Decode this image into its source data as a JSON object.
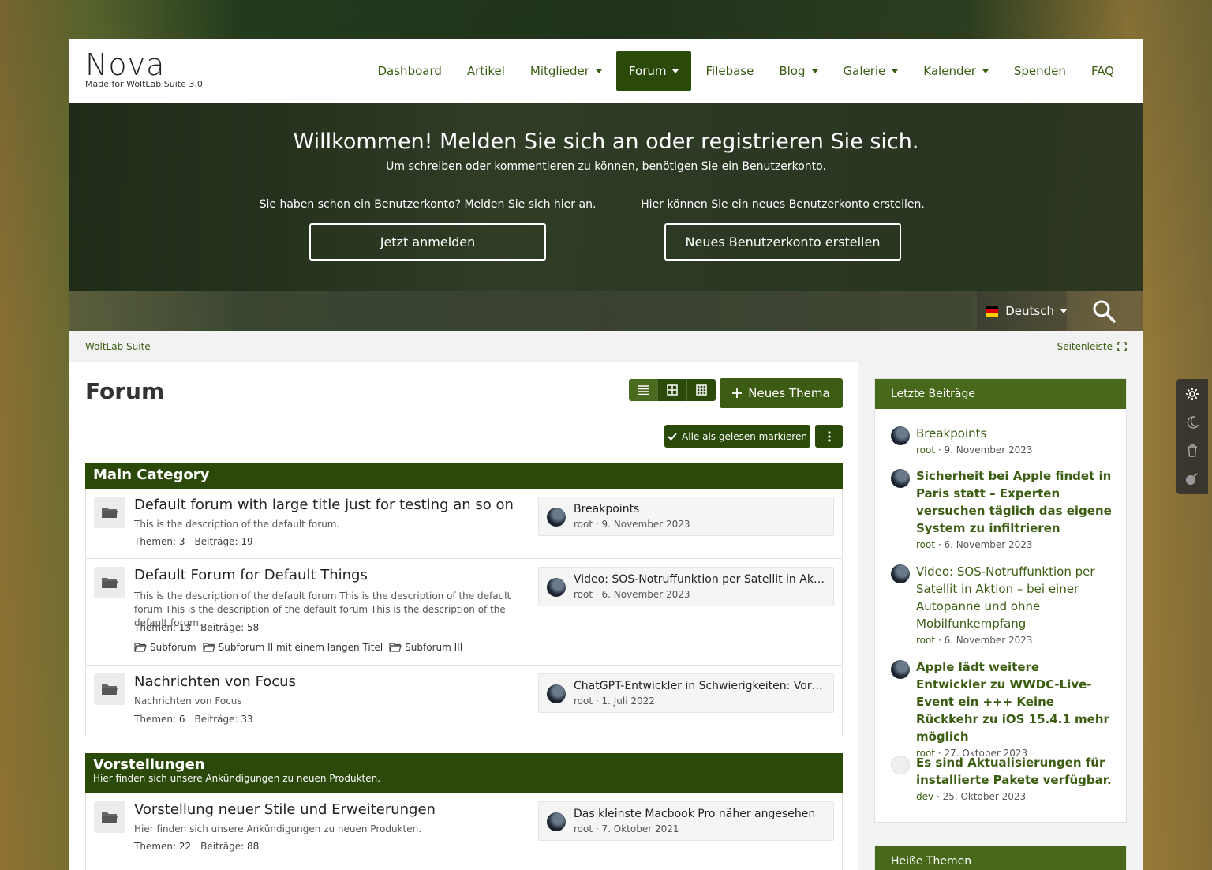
{
  "logo": {
    "name": "Nova",
    "sub": "Made for WoltLab Suite 3.0"
  },
  "nav": [
    {
      "label": "Dashboard",
      "caret": false,
      "active": false
    },
    {
      "label": "Artikel",
      "caret": false,
      "active": false
    },
    {
      "label": "Mitglieder",
      "caret": true,
      "active": false
    },
    {
      "label": "Forum",
      "caret": true,
      "active": true
    },
    {
      "label": "Filebase",
      "caret": false,
      "active": false
    },
    {
      "label": "Blog",
      "caret": true,
      "active": false
    },
    {
      "label": "Galerie",
      "caret": true,
      "active": false
    },
    {
      "label": "Kalender",
      "caret": true,
      "active": false
    },
    {
      "label": "Spenden",
      "caret": false,
      "active": false
    },
    {
      "label": "FAQ",
      "caret": false,
      "active": false
    }
  ],
  "hero": {
    "title": "Willkommen! Melden Sie sich an oder registrieren Sie sich.",
    "lead": "Um schreiben oder kommentieren zu können, benötigen Sie ein Benutzerkonto.",
    "login_text": "Sie haben schon ein Benutzerkonto? Melden Sie sich hier an.",
    "login_button": "Jetzt anmelden",
    "register_text": "Hier können Sie ein neues Benutzerkonto erstellen.",
    "register_button": "Neues Benutzerkonto erstellen"
  },
  "search": {
    "language": "Deutsch"
  },
  "breadcrumb": {
    "home": "WoltLab Suite",
    "sidebar_toggle": "Seitenleiste"
  },
  "page": {
    "title": "Forum",
    "new_topic": "Neues Thema",
    "mark_read": "Alle als gelesen markieren"
  },
  "categories": [
    {
      "title": "Main Category",
      "description": ""
    },
    {
      "title": "Vorstellungen",
      "description": "Hier finden sich unsere Ankündigungen zu neuen Produkten."
    }
  ],
  "boards": [
    {
      "name": "Default forum with large title just for testing an so on",
      "description": "This is the description of the default forum.",
      "topics_label": "Themen",
      "topics": "3",
      "posts_label": "Beiträge",
      "posts": "19",
      "last_title": "Breakpoints",
      "last_meta": "root · 9. November 2023"
    },
    {
      "name": "Default Forum for Default Things",
      "description": "This is the description of the default forum This is the description of the default forum This is the description of the default forum This is the description of the default forum.",
      "topics_label": "Themen",
      "topics": "13",
      "posts_label": "Beiträge",
      "posts": "58",
      "subforums": [
        "Subforum",
        "Subforum II mit einem langen Titel",
        "Subforum III"
      ],
      "last_title": "Video: SOS-Notruffunktion per Satellit in Aktion – bei einer Autopanne und ohne Mobilfunkempfang",
      "last_meta": "root · 6. November 2023"
    },
    {
      "name": "Nachrichten von Focus",
      "description": "Nachrichten von Focus",
      "topics_label": "Themen",
      "topics": "6",
      "posts_label": "Beiträge",
      "posts": "33",
      "last_title": "ChatGPT-Entwickler in Schwierigkeiten: Vorstand entlässt Chef",
      "last_meta": "root · 1. Juli 2022"
    },
    {
      "name": "Vorstellung neuer Stile und Erweiterungen",
      "description": "Hier finden sich unsere Ankündigungen zu neuen Produkten.",
      "topics_label": "Themen",
      "topics": "22",
      "posts_label": "Beiträge",
      "posts": "88",
      "last_title": "Das kleinste Macbook Pro näher angesehen",
      "last_meta": "root · 7. Oktober 2021"
    }
  ],
  "sidebar": {
    "recent_title": "Letzte Beiträge",
    "recent": [
      {
        "title": "Breakpoints",
        "user": "root",
        "date": "9. November 2023",
        "bold": false
      },
      {
        "title": "Sicherheit bei Apple findet in Paris statt – Experten versuchen täglich das eigene System zu infiltrieren",
        "user": "root",
        "date": "6. November 2023",
        "bold": true
      },
      {
        "title": "Video: SOS-Notruffunktion per Satellit in Aktion – bei einer Autopanne und ohne Mobilfunkempfang",
        "user": "root",
        "date": "6. November 2023",
        "bold": false
      },
      {
        "title": "Apple lädt weitere Entwickler zu WWDC-Live-Event ein +++ Keine Rückkehr zu iOS 15.4.1 mehr möglich",
        "user": "root",
        "date": "27. Oktober 2023",
        "bold": true
      },
      {
        "title": "Es sind Aktualisierungen für installierte Pakete verfügbar.",
        "user": "dev",
        "date": "25. Oktober 2023",
        "bold": true
      }
    ],
    "hot_title": "Heiße Themen"
  },
  "colors": {
    "primary": "#2b4a0a",
    "link": "#3b5d12",
    "box_header": "#48691b"
  }
}
